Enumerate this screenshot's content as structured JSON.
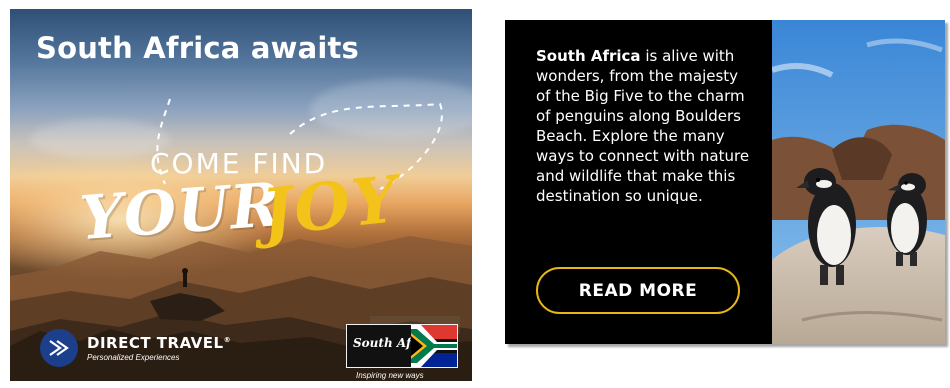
{
  "banner": {
    "headline": "South Africa awaits",
    "tagline_line1": "COME FIND",
    "tagline_your": "YOUR",
    "tagline_joy": "JOY",
    "advertiser": {
      "name": "DIRECT TRAVEL",
      "trademark": "®",
      "slogan": "Personalized Experiences"
    },
    "partner": {
      "wordmark": "South Africa",
      "slogan": "Inspiring new ways"
    }
  },
  "card": {
    "body_bold": "South Africa",
    "body_rest": " is alive with wonders, from the majesty of the Big Five to the charm of penguins along Boulders Beach. Explore the many ways to connect with nature and wildlife that make this destination so unique.",
    "cta_label": "READ MORE",
    "accent_color": "#e8b619"
  },
  "colors": {
    "joy": "#f3c319",
    "dt_blue": "#1c3f8c"
  },
  "icons": {
    "advertiser_logo": "direct-travel-logo-icon",
    "partner_flag": "south-africa-flag-icon"
  }
}
